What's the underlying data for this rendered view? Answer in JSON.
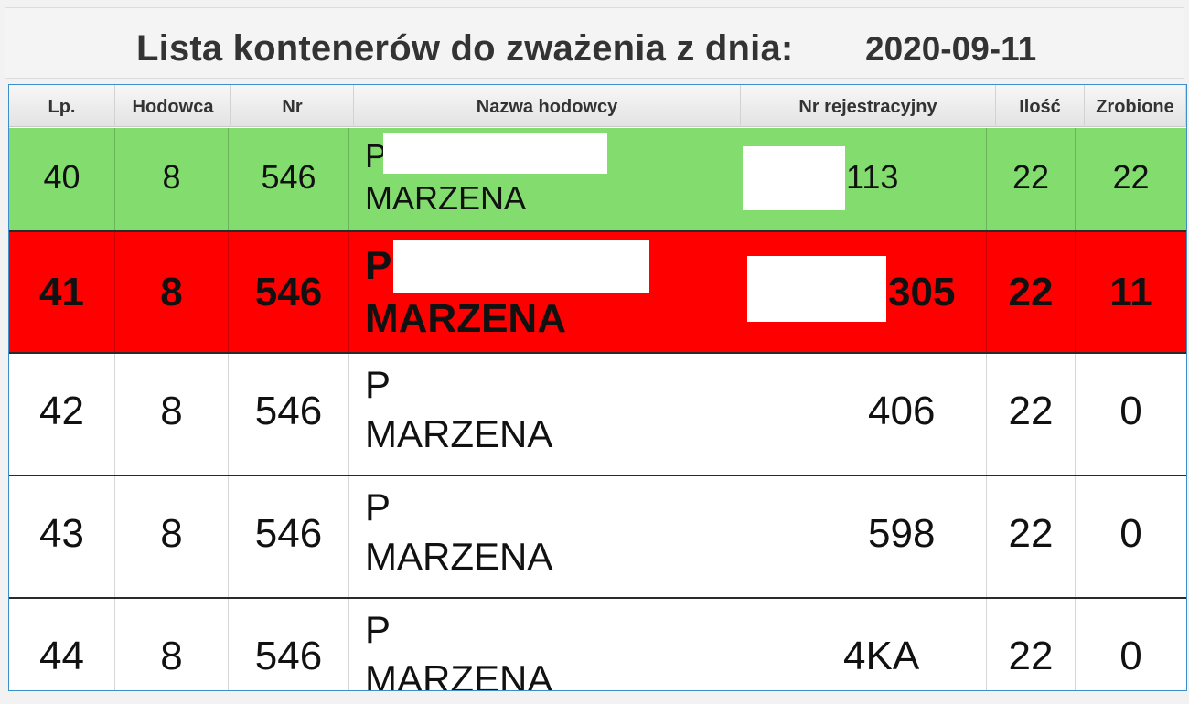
{
  "title": {
    "text": "Lista kontenerów do zważenia z dnia:",
    "date": "2020-09-11"
  },
  "table": {
    "columns": [
      "Lp.",
      "Hodowca",
      "Nr",
      "Nazwa hodowcy",
      "Nr rejestracyjny",
      "Ilość",
      "Zrobione"
    ],
    "rows": [
      {
        "lp": "40",
        "hodowca": "8",
        "nr": "546",
        "name_line1": "P",
        "name_line2": "MARZENA",
        "reg": "113",
        "ilosc": "22",
        "zrobione": "22",
        "status": "complete",
        "color": "#82dd6e"
      },
      {
        "lp": "41",
        "hodowca": "8",
        "nr": "546",
        "name_line1": "P",
        "name_line2": "MARZENA",
        "reg": "305",
        "ilosc": "22",
        "zrobione": "11",
        "status": "in-progress",
        "color": "#ff0000"
      },
      {
        "lp": "42",
        "hodowca": "8",
        "nr": "546",
        "name_line1": "P",
        "name_line2": "MARZENA",
        "reg": "406",
        "ilosc": "22",
        "zrobione": "0",
        "status": "pending",
        "color": "#ffffff"
      },
      {
        "lp": "43",
        "hodowca": "8",
        "nr": "546",
        "name_line1": "P",
        "name_line2": "MARZENA",
        "reg": "598",
        "ilosc": "22",
        "zrobione": "0",
        "status": "pending",
        "color": "#ffffff"
      },
      {
        "lp": "44",
        "hodowca": "8",
        "nr": "546",
        "name_line1": "P",
        "name_line2": "MARZENA",
        "reg": "4KA",
        "ilosc": "22",
        "zrobione": "0",
        "status": "pending",
        "color": "#ffffff"
      }
    ]
  },
  "colors": {
    "header_text": "#333333",
    "table_border": "#3c8fc8",
    "complete_row": "#82dd6e",
    "active_row": "#ff0000"
  }
}
